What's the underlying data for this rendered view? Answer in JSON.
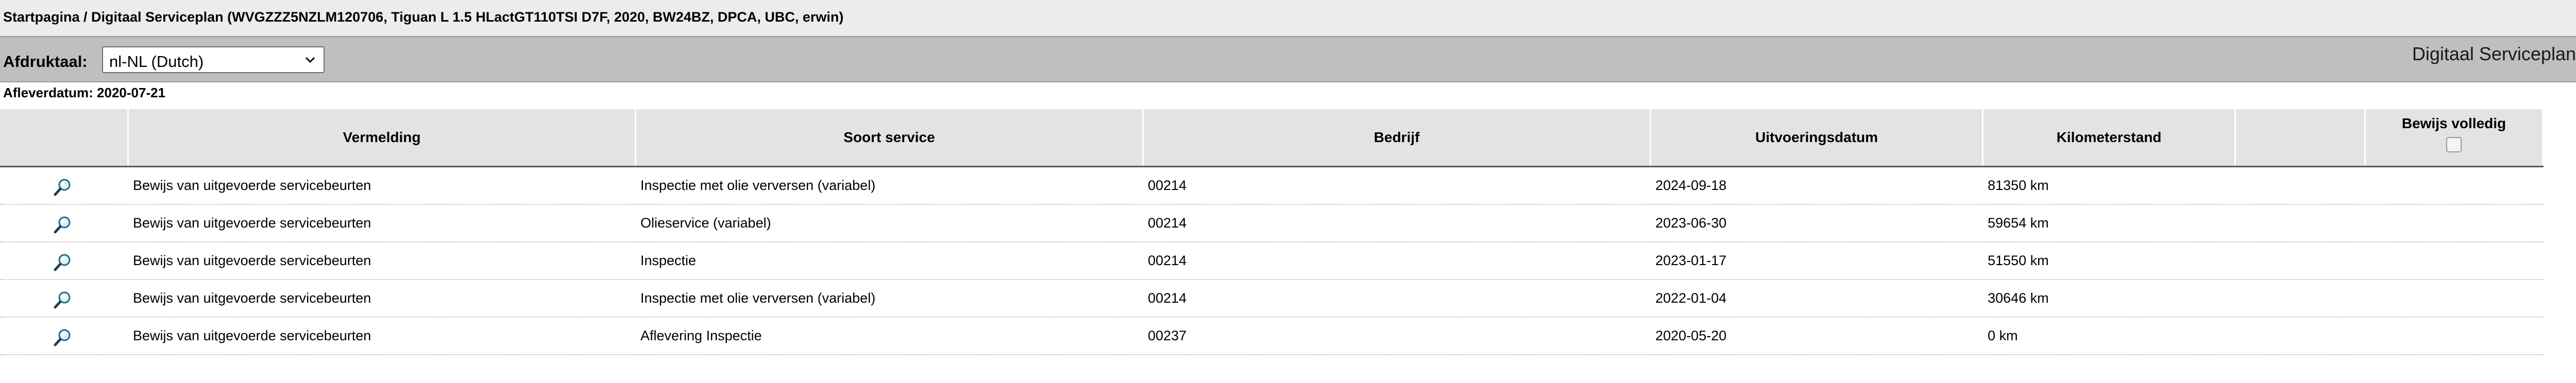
{
  "breadcrumb": "Startpagina / Digitaal Serviceplan (WVGZZZ5NZLM120706, Tiguan L 1.5 HLactGT110TSI D7F, 2020, BW24BZ, DPCA, UBC, erwin)",
  "toolbar": {
    "language_label": "Afdruktaal:",
    "language_selected": "nl-NL (Dutch)",
    "page_title": "Digitaal Serviceplan"
  },
  "delivery_date": "Afleverdatum: 2020-07-21",
  "table": {
    "headers": {
      "vermelding": "Vermelding",
      "soort_service": "Soort service",
      "bedrijf": "Bedrijf",
      "uitvoeringsdatum": "Uitvoeringsdatum",
      "kilometerstand": "Kilometerstand",
      "bewijs_volledig": "Bewijs volledig"
    },
    "rows": [
      {
        "vermelding": "Bewijs van uitgevoerde servicebeurten",
        "soort": "Inspectie met olie verversen (variabel)",
        "bedrijf": "00214",
        "datum": "2024-09-18",
        "km": "81350 km"
      },
      {
        "vermelding": "Bewijs van uitgevoerde servicebeurten",
        "soort": "Olieservice (variabel)",
        "bedrijf": "00214",
        "datum": "2023-06-30",
        "km": "59654 km"
      },
      {
        "vermelding": "Bewijs van uitgevoerde servicebeurten",
        "soort": "Inspectie",
        "bedrijf": "00214",
        "datum": "2023-01-17",
        "km": "51550 km"
      },
      {
        "vermelding": "Bewijs van uitgevoerde servicebeurten",
        "soort": "Inspectie met olie verversen (variabel)",
        "bedrijf": "00214",
        "datum": "2022-01-04",
        "km": "30646 km"
      },
      {
        "vermelding": "Bewijs van uitgevoerde servicebeurten",
        "soort": "Aflevering Inspectie",
        "bedrijf": "00237",
        "datum": "2020-05-20",
        "km": "0 km"
      }
    ]
  }
}
